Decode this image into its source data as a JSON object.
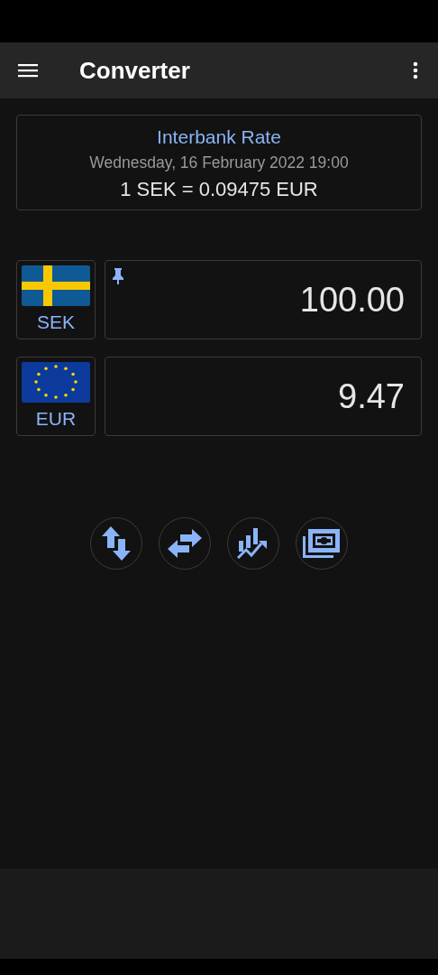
{
  "toolbar": {
    "title": "Converter"
  },
  "rate_card": {
    "title": "Interbank Rate",
    "date": "Wednesday, 16 February 2022 19:00",
    "rate": "1 SEK = 0.09475 EUR"
  },
  "currencies": [
    {
      "code": "SEK",
      "amount": "100.00",
      "pinned": true
    },
    {
      "code": "EUR",
      "amount": "9.47",
      "pinned": false
    }
  ]
}
